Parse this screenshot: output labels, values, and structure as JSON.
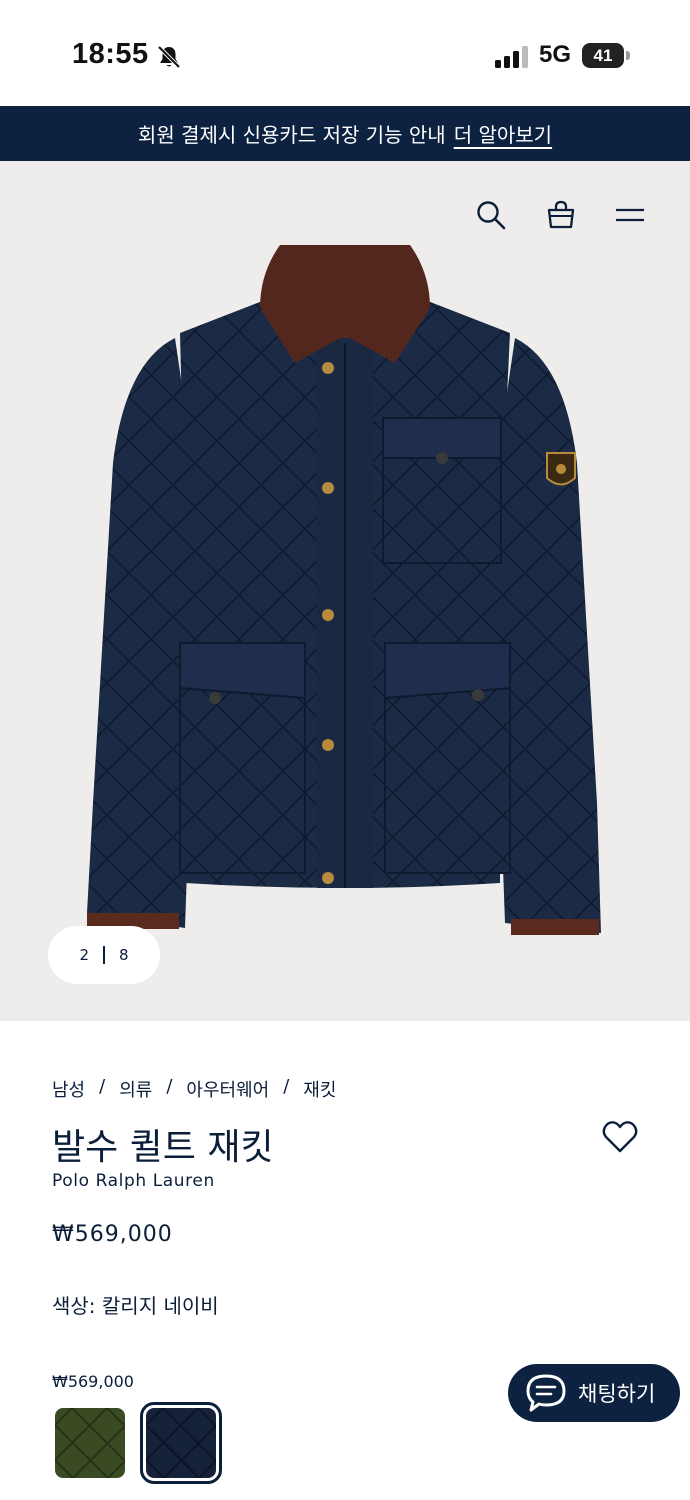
{
  "status_bar": {
    "time": "18:55",
    "network": "5G",
    "battery": "41"
  },
  "banner": {
    "text": "회원 결제시 신용카드 저장 기능 안내",
    "link": "더 알아보기"
  },
  "header": {
    "icons": [
      "search-icon",
      "shopping-bag-icon",
      "hamburger-menu-icon"
    ]
  },
  "gallery": {
    "current": "2",
    "total": "8"
  },
  "product": {
    "breadcrumb": [
      "남성",
      "의류",
      "아우터웨어",
      "재킷"
    ],
    "breadcrumb_separator": "/",
    "title": "발수 퀼트 재킷",
    "brand": "Polo Ralph Lauren",
    "price": "₩569,000",
    "color_label": "색상: 칼리지 네이비",
    "swatch_price": "₩569,000",
    "swatches": [
      {
        "name": "olive",
        "color": "#3a4a23",
        "selected": false
      },
      {
        "name": "navy",
        "color": "#16213a",
        "selected": true
      }
    ]
  },
  "chat": {
    "label": "채팅하기"
  },
  "colors": {
    "navy": "#0d2240",
    "hero_bg": "#efedeb",
    "collar": "#5a2a1e"
  }
}
